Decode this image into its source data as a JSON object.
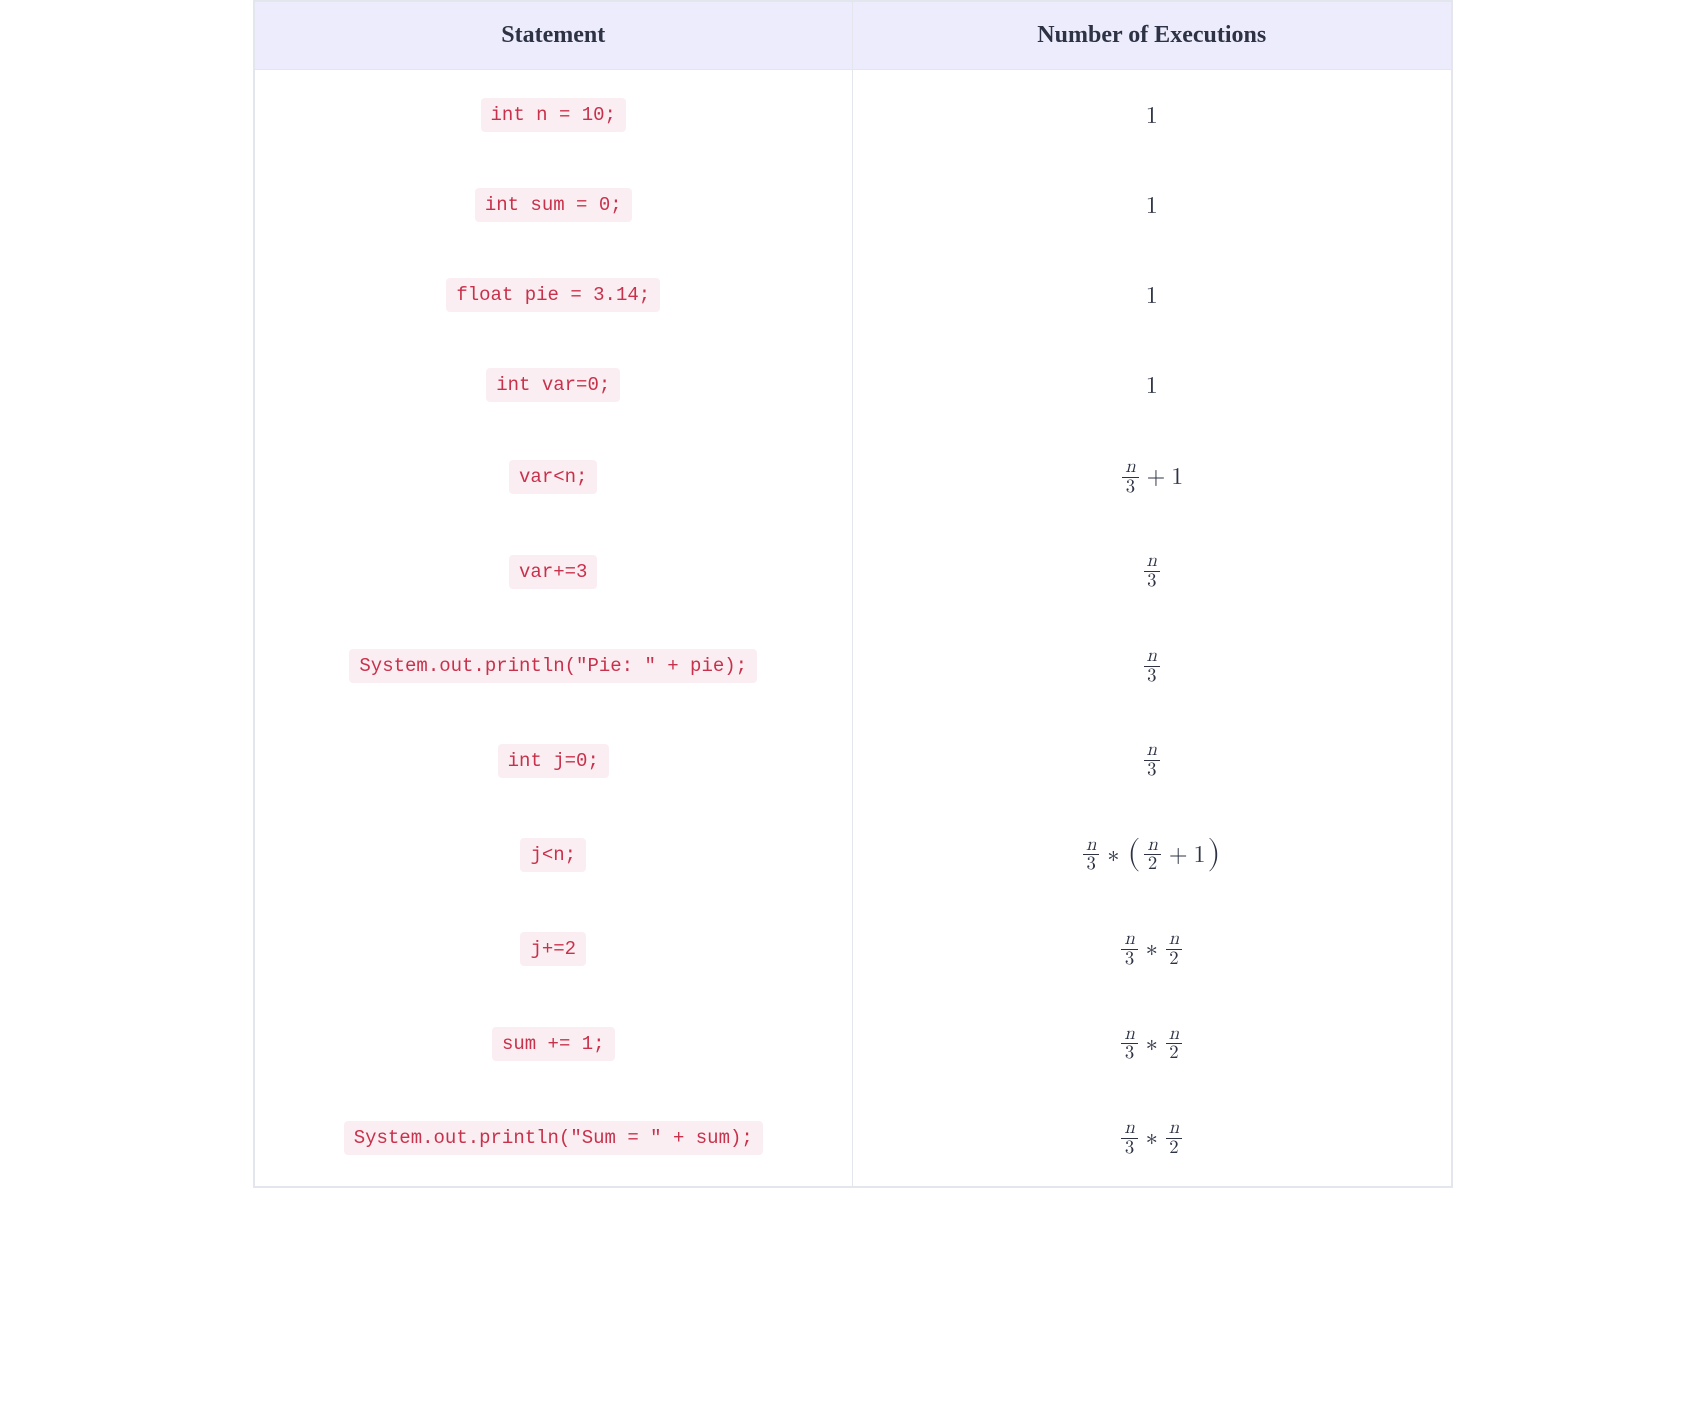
{
  "table": {
    "headers": {
      "col1": "Statement",
      "col2": "Number of Executions"
    },
    "rows": [
      {
        "stmt": "int n = 10;",
        "exec": {
          "type": "plain",
          "value": "1"
        }
      },
      {
        "stmt": "int sum = 0;",
        "exec": {
          "type": "plain",
          "value": "1"
        }
      },
      {
        "stmt": "float pie = 3.14;",
        "exec": {
          "type": "plain",
          "value": "1"
        }
      },
      {
        "stmt": "int var=0;",
        "exec": {
          "type": "plain",
          "value": "1"
        }
      },
      {
        "stmt": "var<n;",
        "exec": {
          "type": "frac_plus",
          "num": "n",
          "den": "3",
          "plus": "1"
        }
      },
      {
        "stmt": "var+=3",
        "exec": {
          "type": "frac",
          "num": "n",
          "den": "3"
        }
      },
      {
        "stmt": "System.out.println(\"Pie: \" + pie);",
        "exec": {
          "type": "frac",
          "num": "n",
          "den": "3"
        }
      },
      {
        "stmt": "int j=0;",
        "exec": {
          "type": "frac",
          "num": "n",
          "den": "3"
        }
      },
      {
        "stmt": "j<n;",
        "exec": {
          "type": "frac_times_paren_frac_plus",
          "a_num": "n",
          "a_den": "3",
          "b_num": "n",
          "b_den": "2",
          "plus": "1"
        }
      },
      {
        "stmt": "j+=2",
        "exec": {
          "type": "frac_times_frac",
          "a_num": "n",
          "a_den": "3",
          "b_num": "n",
          "b_den": "2"
        }
      },
      {
        "stmt": "sum += 1;",
        "exec": {
          "type": "frac_times_frac",
          "a_num": "n",
          "a_den": "3",
          "b_num": "n",
          "b_den": "2"
        }
      },
      {
        "stmt": "System.out.println(\"Sum = \" + sum);",
        "exec": {
          "type": "frac_times_frac",
          "a_num": "n",
          "a_den": "3",
          "b_num": "n",
          "b_den": "2"
        }
      }
    ]
  }
}
